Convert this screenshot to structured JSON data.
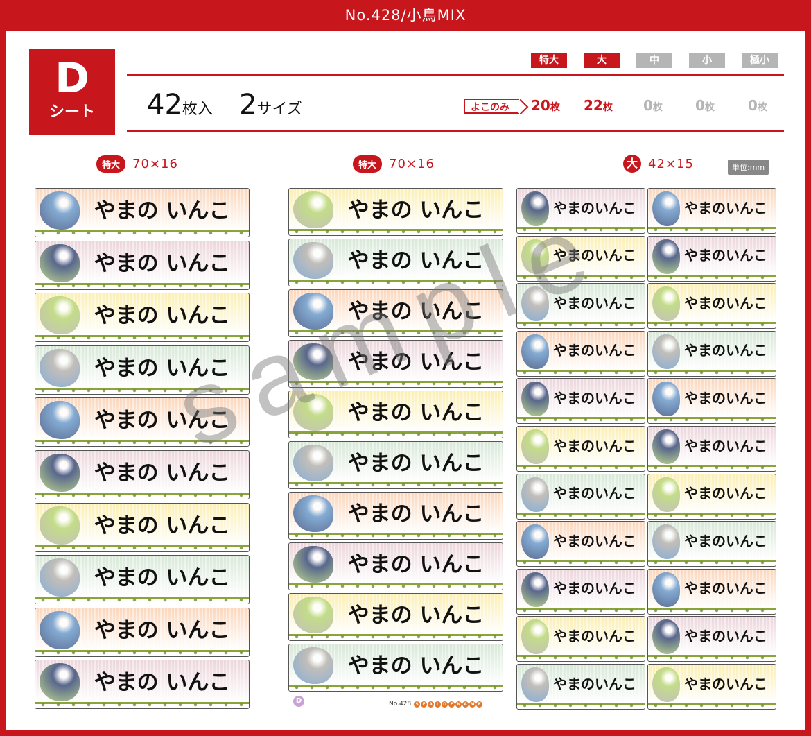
{
  "header": {
    "title": "No.428/小鳥MIX"
  },
  "sheet": {
    "letter": "D",
    "sub": "シート"
  },
  "sizes": [
    {
      "label": "特大",
      "color": "#c8161d"
    },
    {
      "label": "大",
      "color": "#c8161d"
    },
    {
      "label": "中",
      "color": "#b5b5b5"
    },
    {
      "label": "小",
      "color": "#b5b5b5"
    },
    {
      "label": "極小",
      "color": "#b5b5b5"
    }
  ],
  "summary": {
    "count": "42",
    "count_unit": "枚入",
    "sizes": "2",
    "sizes_unit": "サイズ"
  },
  "orientation": "よこのみ",
  "counts": [
    {
      "num": "20",
      "unit": "枚",
      "color": "#c8161d"
    },
    {
      "num": "22",
      "unit": "枚",
      "color": "#c8161d"
    },
    {
      "num": "0",
      "unit": "枚",
      "color": "#b5b5b5"
    },
    {
      "num": "0",
      "unit": "枚",
      "color": "#b5b5b5"
    },
    {
      "num": "0",
      "unit": "枚",
      "color": "#b5b5b5"
    }
  ],
  "columns": [
    {
      "badge": "特大",
      "dims": "70×16"
    },
    {
      "badge": "特大",
      "dims": "70×16"
    },
    {
      "badge": "大",
      "dims": "42×15"
    }
  ],
  "unit_label": "単位:mm",
  "label_text_wide": "やまの いんこ",
  "label_text_small": "やまのいんこ",
  "watermark": "sample",
  "footer": {
    "badge": "D",
    "no": "No.428",
    "brand": "SEALDENAME"
  },
  "palette": {
    "peach": "#fbd7bd",
    "pink": "#ecd6dc",
    "yellow": "#fbefb4",
    "mint": "#d8e8d8",
    "bird_blue": "#6f9fd0",
    "bird_navy": "#3c4f7a",
    "bird_green": "#b9d77a",
    "bird_grey": "#b9b4b0",
    "accent": "#c8161d"
  }
}
